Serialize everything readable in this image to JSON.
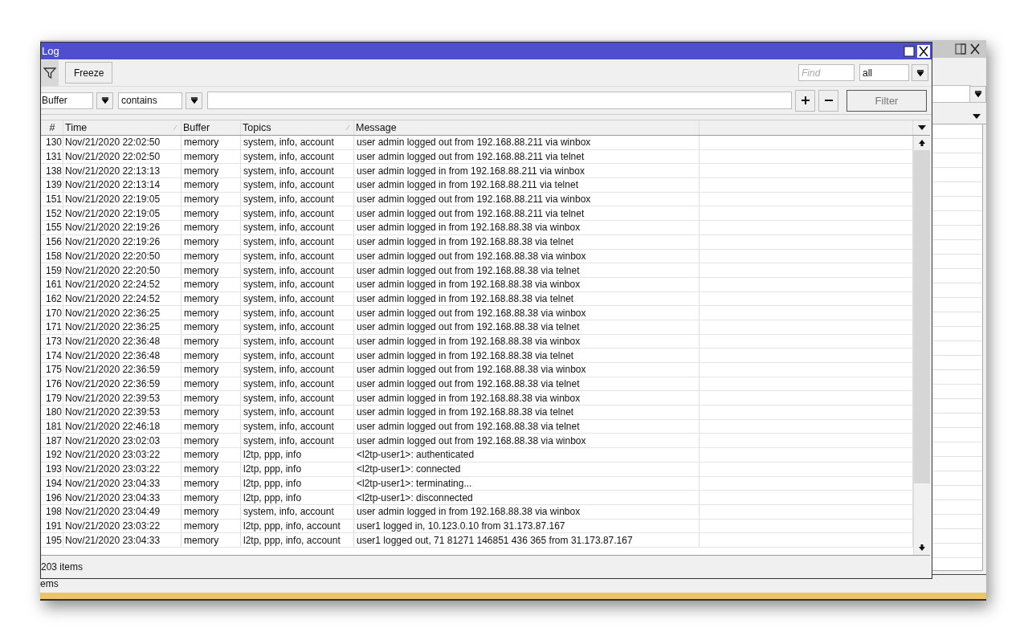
{
  "background_window": {
    "status_text": "ems"
  },
  "window": {
    "title": "Log"
  },
  "toolbar": {
    "freeze_button": "Freeze",
    "find": {
      "placeholder": "Find"
    },
    "find_scope": "all"
  },
  "filter_bar": {
    "field": "Buffer",
    "operator": "contains",
    "button": "Filter"
  },
  "table": {
    "columns": [
      {
        "label": "#",
        "sort_indicator": false
      },
      {
        "label": "Time",
        "sort_indicator": true
      },
      {
        "label": "Buffer",
        "sort_indicator": false
      },
      {
        "label": "Topics",
        "sort_indicator": true
      },
      {
        "label": "Message",
        "sort_indicator": false
      }
    ],
    "rows": [
      {
        "num": "130",
        "time": "Nov/21/2020 22:02:50",
        "buffer": "memory",
        "topics": "system, info, account",
        "message": "user admin logged out from 192.168.88.211 via winbox"
      },
      {
        "num": "131",
        "time": "Nov/21/2020 22:02:50",
        "buffer": "memory",
        "topics": "system, info, account",
        "message": "user admin logged out from 192.168.88.211 via telnet"
      },
      {
        "num": "138",
        "time": "Nov/21/2020 22:13:13",
        "buffer": "memory",
        "topics": "system, info, account",
        "message": "user admin logged in from 192.168.88.211 via winbox"
      },
      {
        "num": "139",
        "time": "Nov/21/2020 22:13:14",
        "buffer": "memory",
        "topics": "system, info, account",
        "message": "user admin logged in from 192.168.88.211 via telnet"
      },
      {
        "num": "151",
        "time": "Nov/21/2020 22:19:05",
        "buffer": "memory",
        "topics": "system, info, account",
        "message": "user admin logged out from 192.168.88.211 via winbox"
      },
      {
        "num": "152",
        "time": "Nov/21/2020 22:19:05",
        "buffer": "memory",
        "topics": "system, info, account",
        "message": "user admin logged out from 192.168.88.211 via telnet"
      },
      {
        "num": "155",
        "time": "Nov/21/2020 22:19:26",
        "buffer": "memory",
        "topics": "system, info, account",
        "message": "user admin logged in from 192.168.88.38 via winbox"
      },
      {
        "num": "156",
        "time": "Nov/21/2020 22:19:26",
        "buffer": "memory",
        "topics": "system, info, account",
        "message": "user admin logged in from 192.168.88.38 via telnet"
      },
      {
        "num": "158",
        "time": "Nov/21/2020 22:20:50",
        "buffer": "memory",
        "topics": "system, info, account",
        "message": "user admin logged out from 192.168.88.38 via winbox"
      },
      {
        "num": "159",
        "time": "Nov/21/2020 22:20:50",
        "buffer": "memory",
        "topics": "system, info, account",
        "message": "user admin logged out from 192.168.88.38 via telnet"
      },
      {
        "num": "161",
        "time": "Nov/21/2020 22:24:52",
        "buffer": "memory",
        "topics": "system, info, account",
        "message": "user admin logged in from 192.168.88.38 via winbox"
      },
      {
        "num": "162",
        "time": "Nov/21/2020 22:24:52",
        "buffer": "memory",
        "topics": "system, info, account",
        "message": "user admin logged in from 192.168.88.38 via telnet"
      },
      {
        "num": "170",
        "time": "Nov/21/2020 22:36:25",
        "buffer": "memory",
        "topics": "system, info, account",
        "message": "user admin logged out from 192.168.88.38 via winbox"
      },
      {
        "num": "171",
        "time": "Nov/21/2020 22:36:25",
        "buffer": "memory",
        "topics": "system, info, account",
        "message": "user admin logged out from 192.168.88.38 via telnet"
      },
      {
        "num": "173",
        "time": "Nov/21/2020 22:36:48",
        "buffer": "memory",
        "topics": "system, info, account",
        "message": "user admin logged in from 192.168.88.38 via winbox"
      },
      {
        "num": "174",
        "time": "Nov/21/2020 22:36:48",
        "buffer": "memory",
        "topics": "system, info, account",
        "message": "user admin logged in from 192.168.88.38 via telnet"
      },
      {
        "num": "175",
        "time": "Nov/21/2020 22:36:59",
        "buffer": "memory",
        "topics": "system, info, account",
        "message": "user admin logged out from 192.168.88.38 via winbox"
      },
      {
        "num": "176",
        "time": "Nov/21/2020 22:36:59",
        "buffer": "memory",
        "topics": "system, info, account",
        "message": "user admin logged out from 192.168.88.38 via telnet"
      },
      {
        "num": "179",
        "time": "Nov/21/2020 22:39:53",
        "buffer": "memory",
        "topics": "system, info, account",
        "message": "user admin logged in from 192.168.88.38 via winbox"
      },
      {
        "num": "180",
        "time": "Nov/21/2020 22:39:53",
        "buffer": "memory",
        "topics": "system, info, account",
        "message": "user admin logged in from 192.168.88.38 via telnet"
      },
      {
        "num": "181",
        "time": "Nov/21/2020 22:46:18",
        "buffer": "memory",
        "topics": "system, info, account",
        "message": "user admin logged out from 192.168.88.38 via telnet"
      },
      {
        "num": "187",
        "time": "Nov/21/2020 23:02:03",
        "buffer": "memory",
        "topics": "system, info, account",
        "message": "user admin logged out from 192.168.88.38 via winbox"
      },
      {
        "num": "192",
        "time": "Nov/21/2020 23:03:22",
        "buffer": "memory",
        "topics": "l2tp, ppp, info",
        "message": "<l2tp-user1>: authenticated"
      },
      {
        "num": "193",
        "time": "Nov/21/2020 23:03:22",
        "buffer": "memory",
        "topics": "l2tp, ppp, info",
        "message": "<l2tp-user1>: connected"
      },
      {
        "num": "194",
        "time": "Nov/21/2020 23:04:33",
        "buffer": "memory",
        "topics": "l2tp, ppp, info",
        "message": "<l2tp-user1>: terminating..."
      },
      {
        "num": "196",
        "time": "Nov/21/2020 23:04:33",
        "buffer": "memory",
        "topics": "l2tp, ppp, info",
        "message": "<l2tp-user1>: disconnected"
      },
      {
        "num": "198",
        "time": "Nov/21/2020 23:04:49",
        "buffer": "memory",
        "topics": "system, info, account",
        "message": "user admin logged in from 192.168.88.38 via winbox"
      },
      {
        "num": "191",
        "time": "Nov/21/2020 23:03:22",
        "buffer": "memory",
        "topics": "l2tp, ppp, info, account",
        "message": "user1 logged in, 10.123.0.10 from 31.173.87.167"
      },
      {
        "num": "195",
        "time": "Nov/21/2020 23:04:33",
        "buffer": "memory",
        "topics": "l2tp, ppp, info, account",
        "message": "user1 logged out, 71 81271 146851 436 365 from 31.173.87.167"
      }
    ]
  },
  "status_bar": {
    "count": "203 items"
  }
}
